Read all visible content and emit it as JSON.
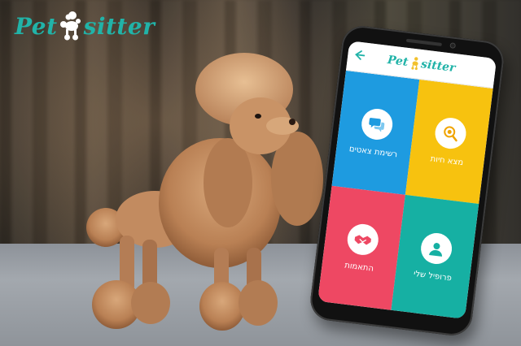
{
  "brand": {
    "name_left": "Pet",
    "name_right": "sitter",
    "color": "#21b3a8"
  },
  "app": {
    "header": {
      "logo_left": "Pet",
      "logo_right": "sitter",
      "back_icon": "arrow-left-icon"
    },
    "tiles": [
      {
        "key": "chat-list",
        "label": "רשימת צאטים",
        "color": "#1e9be0",
        "icon": "chat-bubbles-icon"
      },
      {
        "key": "find-pets",
        "label": "מצא חיות",
        "color": "#f7c20f",
        "icon": "search-pets-icon"
      },
      {
        "key": "matches",
        "label": "התאמות",
        "color": "#ee4863",
        "icon": "handshake-icon"
      },
      {
        "key": "my-profile",
        "label": "פרופיל שלי",
        "color": "#16b0a3",
        "icon": "user-profile-icon"
      }
    ]
  }
}
